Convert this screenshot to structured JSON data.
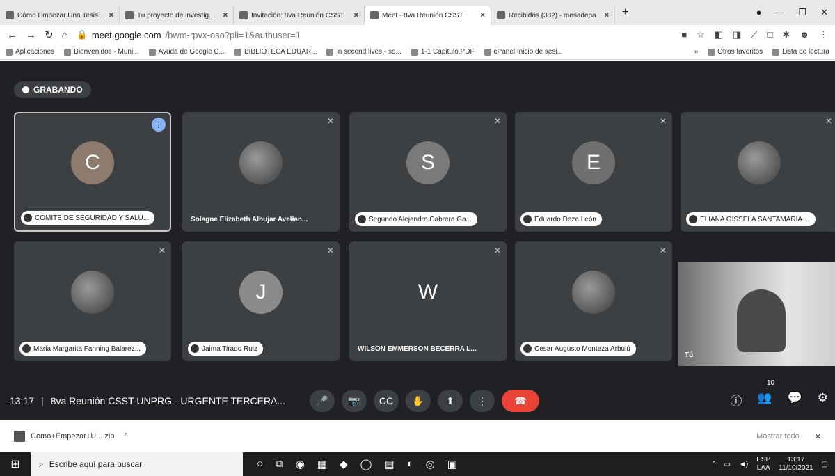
{
  "browser": {
    "tabs": [
      {
        "title": "Cómo Empezar Una Tesis (1:",
        "active": false
      },
      {
        "title": "Tu proyecto de investigación:",
        "active": false
      },
      {
        "title": "Invitación: 8va Reunión CSST",
        "active": false
      },
      {
        "title": "Meet - 8va Reunión CSST",
        "active": true
      },
      {
        "title": "Recibidos (382) - mesadepa",
        "active": false
      }
    ],
    "new_tab": "+",
    "window_controls": {
      "minimize": "—",
      "maximize": "❐",
      "close": "✕"
    },
    "url_host": "meet.google.com",
    "url_path": "/bwm-rpvx-oso?pli=1&authuser=1",
    "bookmarks": [
      {
        "label": "Aplicaciones"
      },
      {
        "label": "Bienvenidos - Muni..."
      },
      {
        "label": "Ayuda de Google C..."
      },
      {
        "label": "BIBLIOTECA EDUAR..."
      },
      {
        "label": "in second lives - so..."
      },
      {
        "label": "1-1 Capitulo.PDF"
      },
      {
        "label": "cPanel Inicio de sesi..."
      }
    ],
    "bookmarks_more": "»",
    "other_favorites": "Otros favoritos",
    "reading_list": "Lista de lectura"
  },
  "meet": {
    "recording_label": "GRABANDO",
    "time": "13:17",
    "separator": "|",
    "meeting_title": "8va Reunión CSST-UNPRG - URGENTE TERCERA...",
    "participants_badge": "10",
    "self_label": "Tú",
    "tiles": [
      {
        "initial": "C",
        "name": "COMITÉ DE SEGURIDAD Y SALU...",
        "avatar_color": "#8d7b6e",
        "photo": false
      },
      {
        "initial": "",
        "name": "Solagne Elizabeth Albujar Avellan...",
        "avatar_color": "#555555",
        "photo": true
      },
      {
        "initial": "S",
        "name": "Segundo Alejandro Cabrera Ga...",
        "avatar_color": "#7a7a7a",
        "photo": false
      },
      {
        "initial": "E",
        "name": "Eduardo Deza León",
        "avatar_color": "#6f6f6f",
        "photo": false
      },
      {
        "initial": "",
        "name": "ELIANA GISSELA SANTAMARIA ...",
        "avatar_color": "#555555",
        "photo": true
      },
      {
        "initial": "",
        "name": "Maria Margarita Fanning Balarez...",
        "avatar_color": "#555555",
        "photo": true
      },
      {
        "initial": "J",
        "name": "Jaima Tirado Ruiz",
        "avatar_color": "#8b8b8b",
        "photo": false
      },
      {
        "initial": "W",
        "name": "WILSON EMMERSON BECERRA L...",
        "avatar_color": "#3c4043",
        "photo": false
      },
      {
        "initial": "",
        "name": "Cesar Augusto Monteza Arbulú",
        "avatar_color": "#555555",
        "photo": true
      }
    ],
    "controls": [
      "🎤",
      "📷",
      "CC",
      "✋",
      "⬆",
      "⋮",
      "☎"
    ],
    "right_controls": [
      "ⓘ",
      "👥",
      "💬",
      "⚙"
    ]
  },
  "downloads": {
    "file": "Como+Empezar+U....zip",
    "caret": "^",
    "show_all": "Mostrar todo",
    "close": "✕"
  },
  "taskbar": {
    "search_placeholder": "Escribe aquí para buscar",
    "lang_top": "ESP",
    "lang_bottom": "LAA",
    "clock_time": "13:17",
    "clock_date": "11/10/2021"
  }
}
